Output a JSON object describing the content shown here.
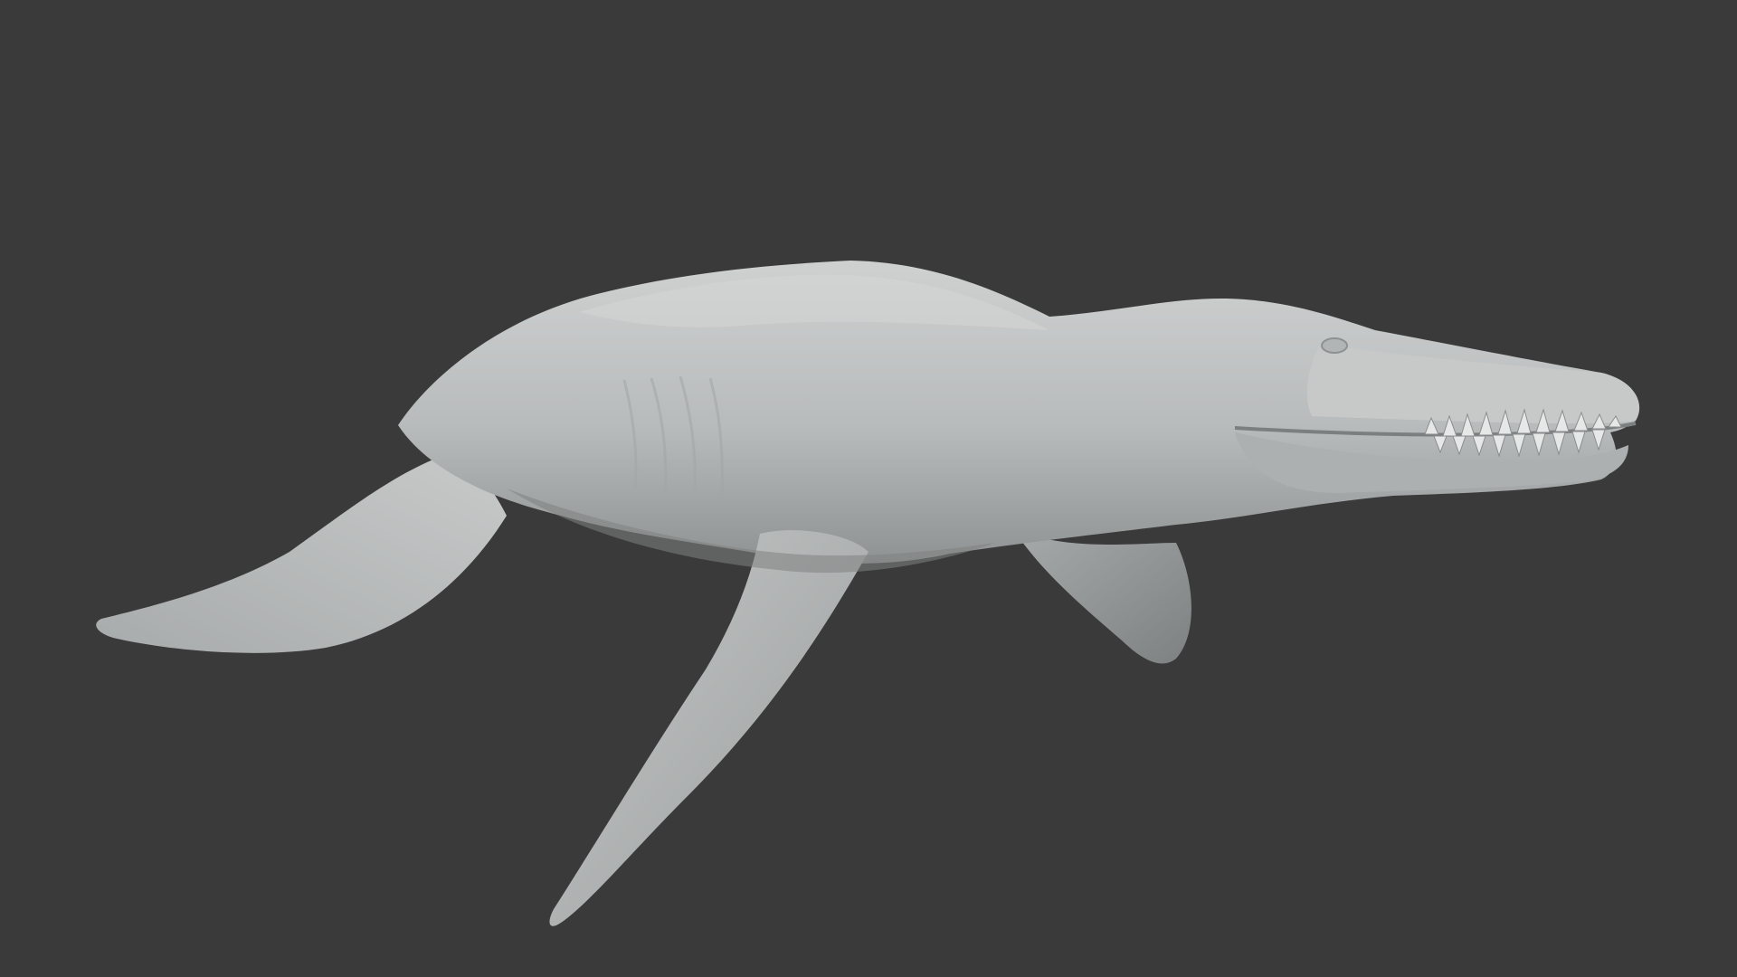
{
  "viewport": {
    "background_color": "#3a3a3a"
  },
  "model": {
    "subject": "marine-reptile-sculpt",
    "surface_color": "#b9bcbc",
    "shadow_color": "#8d9090",
    "highlight_color": "#d4d6d6"
  }
}
